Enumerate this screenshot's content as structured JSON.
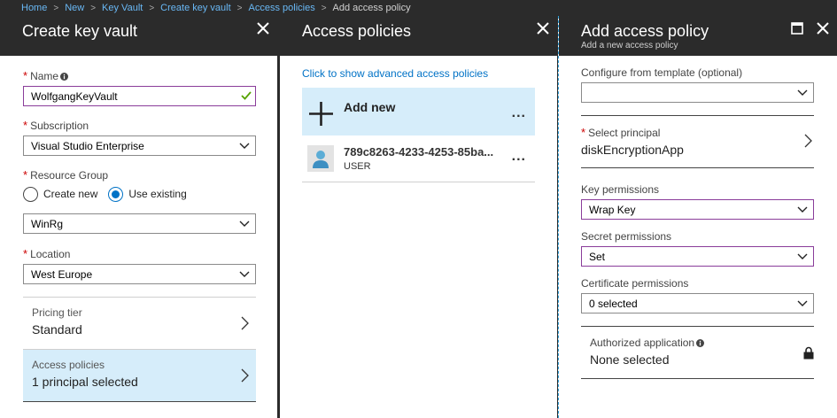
{
  "breadcrumb": [
    "Home",
    "New",
    "Key Vault",
    "Create key vault",
    "Access policies",
    "Add access policy"
  ],
  "blade1": {
    "title": "Create key vault",
    "name_label": "Name",
    "name_value": "WolfgangKeyVault",
    "subscription_label": "Subscription",
    "subscription_value": "Visual Studio Enterprise",
    "resource_group_label": "Resource Group",
    "create_new_label": "Create new",
    "use_existing_label": "Use existing",
    "resource_group_value": "WinRg",
    "location_label": "Location",
    "location_value": "West Europe",
    "pricing_tier_label": "Pricing tier",
    "pricing_tier_value": "Standard",
    "access_policies_label": "Access policies",
    "access_policies_value": "1 principal selected"
  },
  "blade2": {
    "title": "Access policies",
    "advanced_link": "Click to show advanced access policies",
    "add_new_label": "Add new",
    "ellipsis": "...",
    "policy_name": "789c8263-4233-4253-85ba...",
    "policy_type": "USER"
  },
  "blade3": {
    "title": "Add access policy",
    "subtitle": "Add a new access policy",
    "template_label": "Configure from template (optional)",
    "template_value": "",
    "principal_label": "Select principal",
    "principal_value": "diskEncryptionApp",
    "key_permissions_label": "Key permissions",
    "key_permissions_value": "Wrap Key",
    "secret_permissions_label": "Secret permissions",
    "secret_permissions_value": "Set",
    "certificate_permissions_label": "Certificate permissions",
    "certificate_permissions_value": "0 selected",
    "authorized_app_label": "Authorized application",
    "authorized_app_value": "None selected"
  },
  "colors": {
    "chrome": "#2b2b2b",
    "link": "#0072c6",
    "selected_bg": "#d6edfa",
    "focus_border": "#8a3c9a",
    "required": "#c00000"
  }
}
